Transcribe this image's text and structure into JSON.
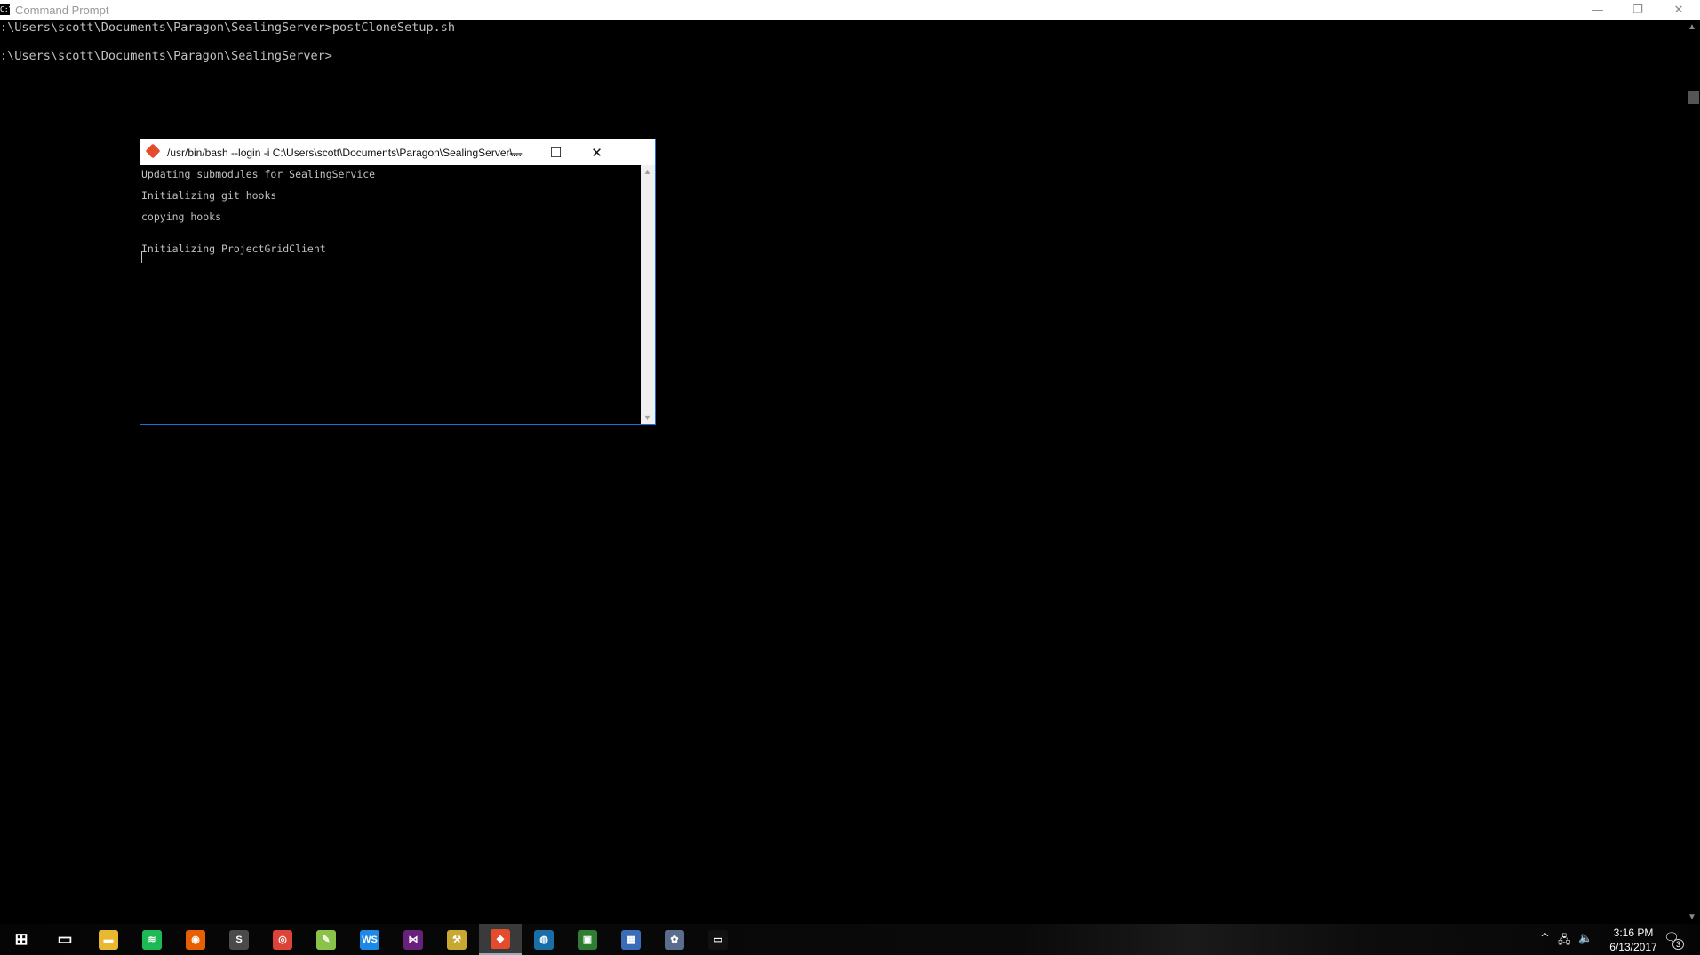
{
  "cmd": {
    "title": "Command Prompt",
    "icon_text": "C:\\",
    "lines": [
      ":\\Users\\scott\\Documents\\Paragon\\SealingServer>postCloneSetup.sh",
      ":\\Users\\scott\\Documents\\Paragon\\SealingServer>"
    ],
    "min_glyph": "—",
    "restore_glyph": "❐",
    "close_glyph": "✕"
  },
  "bash": {
    "title": "/usr/bin/bash --login -i C:\\Users\\scott\\Documents\\Paragon\\SealingServer\\...",
    "lines": [
      "Updating submodules for SealingService",
      "Initializing git hooks",
      "copying hooks",
      "Initializing ProjectGridClient"
    ],
    "min_glyph": "—",
    "max_glyph": "☐",
    "close_glyph": "✕"
  },
  "taskbar": {
    "items": [
      {
        "name": "windows-start-icon",
        "glyph": "⊞",
        "color": "#000000"
      },
      {
        "name": "task-view-icon",
        "glyph": "▭",
        "color": "#000000"
      },
      {
        "name": "file-explorer-icon",
        "glyph": "▬",
        "color": "#e8b830"
      },
      {
        "name": "spotify-icon",
        "glyph": "≋",
        "color": "#1db954"
      },
      {
        "name": "firefox-icon",
        "glyph": "◉",
        "color": "#e66000"
      },
      {
        "name": "sublime-text-icon",
        "glyph": "S",
        "color": "#4a4a4a"
      },
      {
        "name": "chrome-icon",
        "glyph": "◎",
        "color": "#db4437"
      },
      {
        "name": "notepad-plus-plus-icon",
        "glyph": "✎",
        "color": "#8bc34a"
      },
      {
        "name": "webstorm-icon",
        "glyph": "WS",
        "color": "#1e88e5"
      },
      {
        "name": "visual-studio-icon",
        "glyph": "⋈",
        "color": "#68217a"
      },
      {
        "name": "tools-icon",
        "glyph": "⚒",
        "color": "#c8a830"
      },
      {
        "name": "git-bash-icon",
        "glyph": "◆",
        "color": "#e44c2c"
      },
      {
        "name": "globe-app-icon",
        "glyph": "◍",
        "color": "#1a6ea8"
      },
      {
        "name": "network-tool-icon",
        "glyph": "▣",
        "color": "#2e7d32"
      },
      {
        "name": "database-manager-icon",
        "glyph": "▦",
        "color": "#3b6cb8"
      },
      {
        "name": "paint-icon",
        "glyph": "✿",
        "color": "#5a6d8c"
      },
      {
        "name": "command-prompt-taskbar-icon",
        "glyph": "▭",
        "color": "#111111"
      }
    ],
    "active_index": 11
  },
  "tray": {
    "chevron": "^",
    "network": "🖧",
    "volume": "🔈",
    "time": "3:16 PM",
    "date": "6/13/2017",
    "notif_glyph": "🗨",
    "notif_count": "3"
  }
}
